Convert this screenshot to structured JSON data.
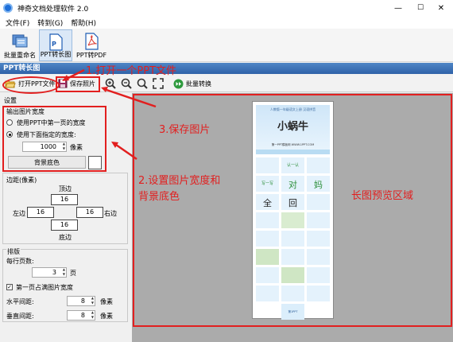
{
  "window": {
    "title": "神奇文档处理软件 2.0",
    "minimize": "—",
    "maximize": "☐",
    "close": "✕"
  },
  "menu": [
    {
      "label": "文件(F)"
    },
    {
      "label": "转到(G)"
    },
    {
      "label": "帮助(H)"
    }
  ],
  "ribbon": [
    {
      "label": "批量重命名",
      "icon": "rename-icon"
    },
    {
      "label": "PPT转长图",
      "icon": "ppt-icon"
    },
    {
      "label": "PPT转PDF",
      "icon": "pdf-icon"
    }
  ],
  "panel_title": "PPT转长图",
  "toolbar": {
    "open_ppt": "打开PPT文件",
    "save_image": "保存照片",
    "batch_convert": "批量转换"
  },
  "settings": {
    "title": "设置",
    "width_group": "输出图片宽度",
    "option_first_slide": "使用PPT中第一页的宽度",
    "option_custom": "使用下面指定的宽度:",
    "width_value": "1000",
    "width_unit": "像素",
    "bg_color_button": "背景底色",
    "bg_color_swatch": "#ffffff",
    "margin_group": "边距(像素)",
    "margin_top_label": "顶边",
    "margin_left_label": "左边",
    "margin_right_label": "右边",
    "margin_bottom_label": "底边",
    "margin_top": "16",
    "margin_left": "16",
    "margin_right": "16",
    "margin_bottom": "16",
    "layout_group": "排版",
    "per_row_label": "每行页数:",
    "per_row_value": "3",
    "per_row_unit": "页",
    "first_full_width": "第一页占满图片宽度",
    "first_full_width_checked": true,
    "h_spacing_label": "水平间距:",
    "h_spacing_value": "8",
    "h_spacing_unit": "像素",
    "v_spacing_label": "垂直间距:",
    "v_spacing_value": "8",
    "v_spacing_unit": "像素"
  },
  "annotations": {
    "step1": "1.打开一个PPT文件",
    "step2_line1": "2.设置图片宽度和",
    "step2_line2": "背景底色",
    "step3": "3.保存图片",
    "preview_area": "长图预览区域"
  },
  "preview": {
    "cover_small": "人教版一年级语文上册  汉语拼音",
    "cover_title": "小蜗牛",
    "cover_sub": "第一PPT模板网 WWW.1PPT.COM",
    "char_1": "认一认",
    "char_2": "写一写",
    "char_3": "对",
    "char_4": "妈",
    "char_5": "全",
    "char_6": "回",
    "footer": "第1PPT"
  },
  "colors": {
    "accent_red": "#e21f1f",
    "panel_blue": "#2f62a8",
    "preview_bg": "#ababab"
  }
}
